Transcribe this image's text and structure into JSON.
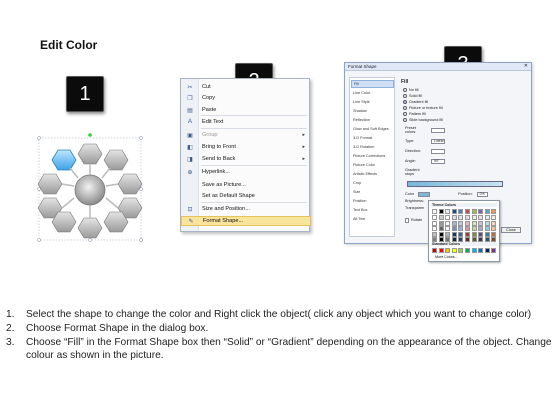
{
  "title": "Edit Color",
  "badges": [
    "1",
    "2",
    "3"
  ],
  "context_menu": {
    "items": [
      {
        "label": "Cut",
        "icon": "scissors-icon",
        "glyph": "✂",
        "disabled": false,
        "underline": true,
        "submenu": false
      },
      {
        "label": "Copy",
        "icon": "copy-icon",
        "glyph": "❐",
        "disabled": false,
        "underline": true,
        "submenu": false
      },
      {
        "label": "Paste",
        "icon": "paste-icon",
        "glyph": "▤",
        "disabled": false,
        "underline": true,
        "submenu": false
      },
      {
        "label": "Edit Text",
        "icon": "edit-text-icon",
        "glyph": "A",
        "disabled": false,
        "underline": false,
        "submenu": false
      },
      {
        "label": "Group",
        "icon": "group-icon",
        "glyph": "▣",
        "disabled": true,
        "underline": false,
        "submenu": true
      },
      {
        "label": "Bring to Front",
        "icon": "bring-front-icon",
        "glyph": "◧",
        "disabled": false,
        "underline": false,
        "submenu": true
      },
      {
        "label": "Send to Back",
        "icon": "send-back-icon",
        "glyph": "◨",
        "disabled": false,
        "underline": false,
        "submenu": true
      },
      {
        "label": "Hyperlink...",
        "icon": "hyperlink-icon",
        "glyph": "⊕",
        "disabled": false,
        "underline": true,
        "submenu": false
      },
      {
        "label": "Save as Picture...",
        "icon": "",
        "glyph": "",
        "disabled": false,
        "underline": false,
        "submenu": false
      },
      {
        "label": "Set as Default Shape",
        "icon": "",
        "glyph": "",
        "disabled": false,
        "underline": false,
        "submenu": false
      },
      {
        "label": "Size and Position...",
        "icon": "size-position-icon",
        "glyph": "⊡",
        "disabled": false,
        "underline": false,
        "submenu": false
      },
      {
        "label": "Format Shape...",
        "icon": "format-shape-icon",
        "glyph": "✎",
        "disabled": false,
        "underline": false,
        "submenu": false,
        "highlighted": true
      }
    ]
  },
  "dialog": {
    "title": "Format Shape",
    "nav": [
      "Fill",
      "Line Color",
      "Line Style",
      "Shadow",
      "Reflection",
      "Glow and Soft Edges",
      "3-D Format",
      "3-D Rotation",
      "Picture Corrections",
      "Picture Color",
      "Artistic Effects",
      "Crop",
      "Size",
      "Position",
      "Text Box",
      "Alt Text"
    ],
    "pane_heading": "Fill",
    "fill_options": [
      "No fill",
      "Solid fill",
      "Gradient fill",
      "Picture or texture fill",
      "Pattern fill",
      "Slide background fill"
    ],
    "selected_fill": "Gradient fill",
    "fields": [
      {
        "label": "Preset colors:",
        "value": ""
      },
      {
        "label": "Type:",
        "value": "Linear"
      },
      {
        "label": "Direction:",
        "value": ""
      },
      {
        "label": "Angle:",
        "value": "90°"
      },
      {
        "label": "Gradient stops",
        "value": ""
      }
    ],
    "color_label": "Color",
    "position_label": "Position:",
    "position_value": "0%",
    "brightness_label": "Brightness:",
    "transparency_label": "Transparen",
    "rotate_label": "Rotate",
    "close_label": "Close"
  },
  "color_popup": {
    "theme_label": "Theme Colors",
    "standard_label": "Standard Colors",
    "more_label": "More Colors...",
    "theme_top": [
      "#ffffff",
      "#000000",
      "#eeece1",
      "#1f497d",
      "#4f81bd",
      "#c0504d",
      "#9bbb59",
      "#8064a2",
      "#4bacc6",
      "#f79646"
    ],
    "standard": [
      "#c00000",
      "#ff0000",
      "#ffc000",
      "#ffff00",
      "#92d050",
      "#00b050",
      "#00b0f0",
      "#0070c0",
      "#002060",
      "#7030a0"
    ]
  },
  "instructions": [
    {
      "num": "1.",
      "text": "Select the shape to change the color and Right click the object( click any object which you want to change color)"
    },
    {
      "num": "2.",
      "text": "Choose Format Shape in the dialog box."
    },
    {
      "num": "3.",
      "text": "Choose “Fill” in the Format Shape box then “Solid” or “Gradient” depending on the appearance of the object. Change colour as shown in the picture."
    }
  ]
}
